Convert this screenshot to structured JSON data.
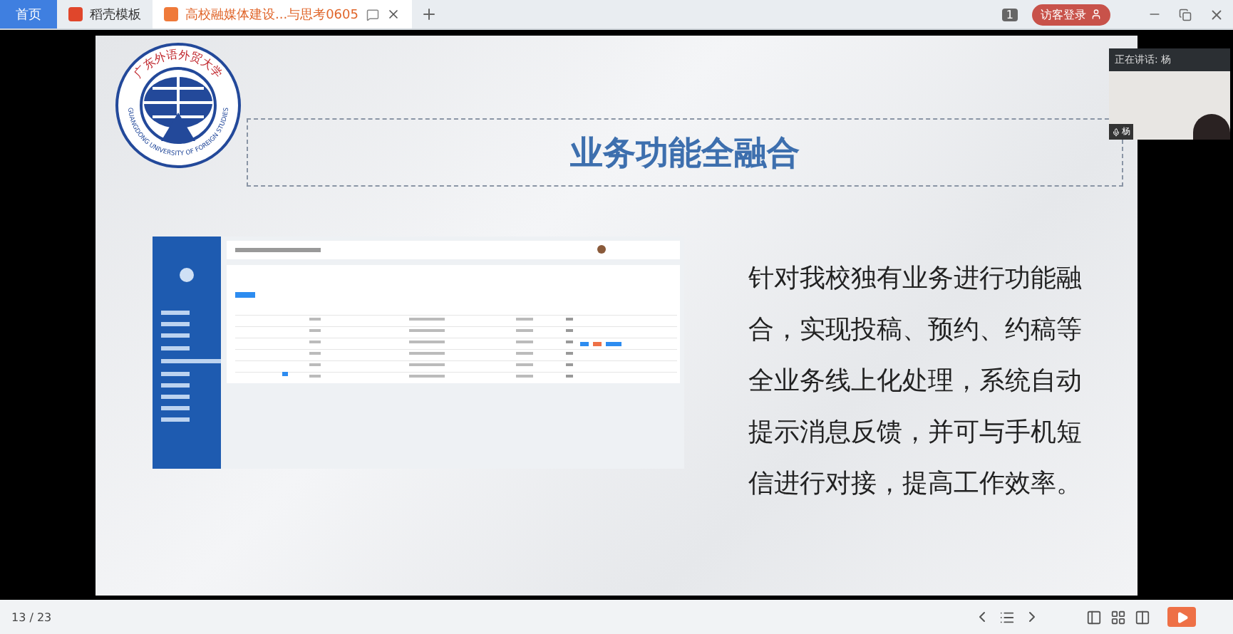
{
  "browser_tabs": [
    {
      "label": "首页",
      "selected": false,
      "kind": "home"
    },
    {
      "label": "稻壳模板",
      "selected": false,
      "kind": "page"
    },
    {
      "label": "高校融媒体建设...与思考0605",
      "selected": true,
      "kind": "page"
    }
  ],
  "toolbar": {
    "window_count": "1",
    "login_button": "访客登录"
  },
  "slide": {
    "logo": {
      "name_cn": "广东外语外贸大学",
      "name_en": "GUANGDONG UNIVERSITY OF FOREIGN STUDIES"
    },
    "title": "业务功能全融合",
    "body": "针对我校独有业务进行功能融合，实现投稿、预约、约稿等全业务线上化处理，系统自动提示消息反馈，并可与手机短信进行对接，提高工作效率。"
  },
  "video_call": {
    "speaking": "正在讲话: 杨",
    "participant": "杨"
  },
  "status_bar": {
    "page": "13 / 23"
  }
}
